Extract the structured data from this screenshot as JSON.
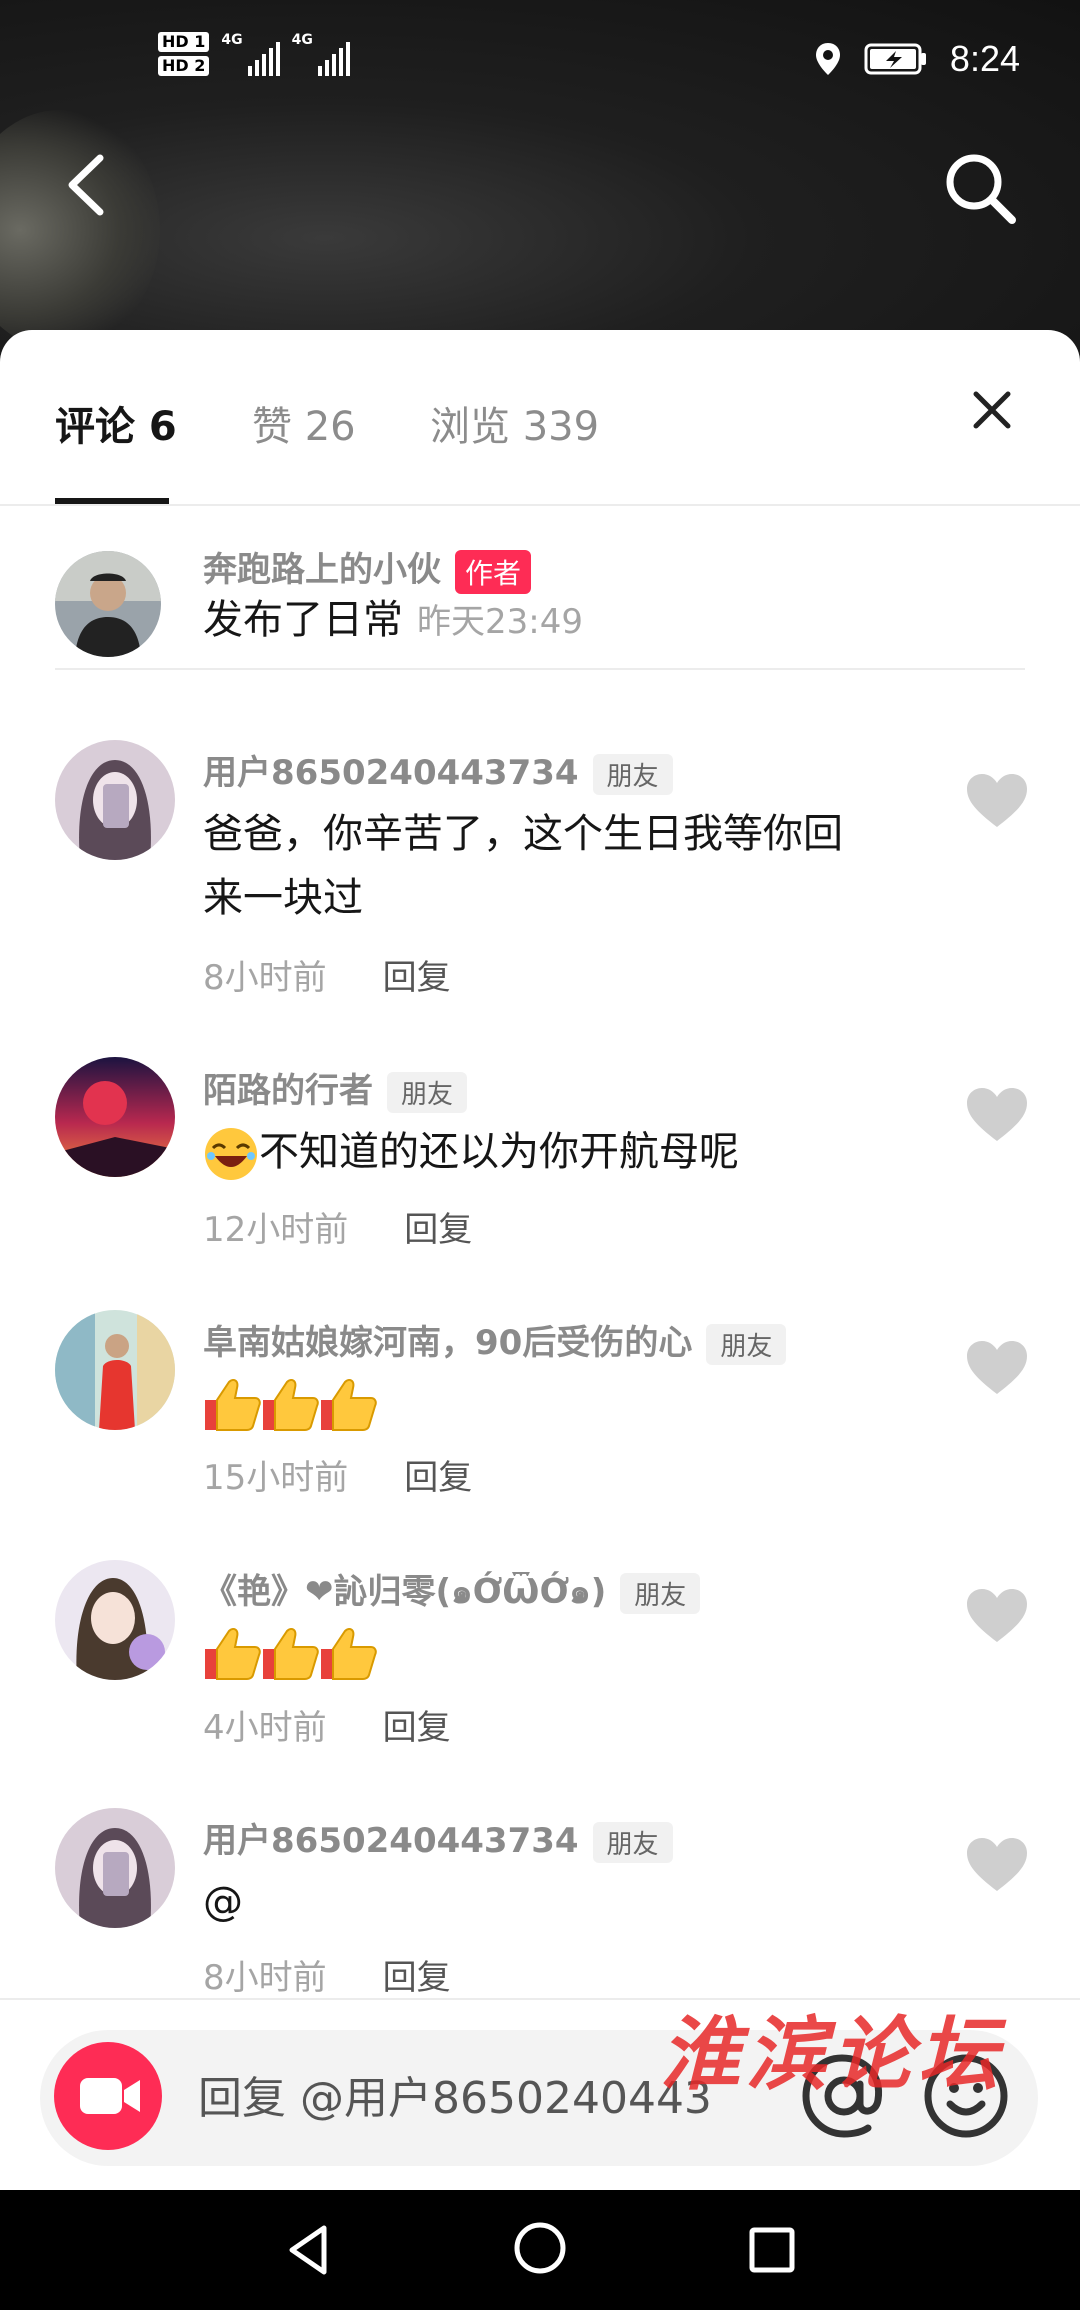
{
  "status_bar": {
    "sim1": "HD 1",
    "sim2": "HD 2",
    "network1": "4G",
    "network2": "4G",
    "time": "8:24"
  },
  "tabs": {
    "comments": "评论 6",
    "likes": "赞 26",
    "views": "浏览 339"
  },
  "author_post": {
    "name": "奔跑路上的小伙",
    "badge": "作者",
    "text": "发布了日常",
    "time": "昨天23:49"
  },
  "comments": [
    {
      "name": "用户8650240443734",
      "badge": "朋友",
      "text_line1": "爸爸，你辛苦了，这个生日我等你回",
      "text_line2": "来一块过",
      "time": "8小时前",
      "reply": "回复"
    },
    {
      "name": "陌路的行者",
      "badge": "朋友",
      "text": "不知道的还以为你开航母呢",
      "time": "12小时前",
      "reply": "回复"
    },
    {
      "name": "阜南姑娘嫁河南，90后受伤的心",
      "badge": "朋友",
      "time": "15小时前",
      "reply": "回复"
    },
    {
      "name": "《艳》❤訫归零(๑ỚѾỚ๑)",
      "badge": "朋友",
      "time": "4小时前",
      "reply": "回复"
    },
    {
      "name": "用户8650240443734",
      "badge": "朋友",
      "text": "@",
      "time": "8小时前",
      "reply": "回复"
    }
  ],
  "input": {
    "placeholder": "回复 @用户8650240443"
  },
  "watermark": "淮滨论坛",
  "colors": {
    "accent": "#fe2c55",
    "muted": "#8a8a8a",
    "text": "#161616"
  }
}
